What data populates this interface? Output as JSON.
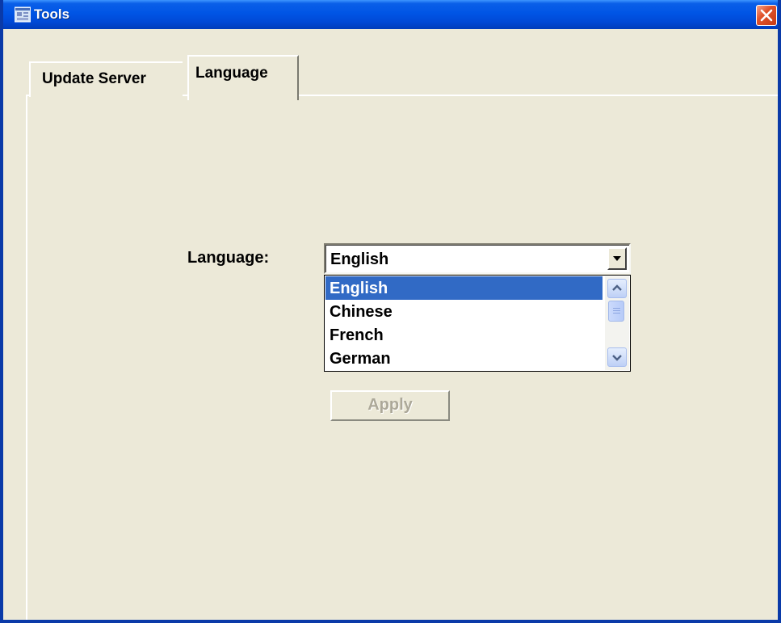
{
  "window": {
    "title": "Tools"
  },
  "tabs": [
    {
      "label": "Update Server",
      "active": false
    },
    {
      "label": "Language",
      "active": true
    }
  ],
  "language": {
    "label": "Language:",
    "selected": "English",
    "options": [
      "English",
      "Chinese",
      "French",
      "German"
    ],
    "highlighted_index": 0
  },
  "apply_label": "Apply",
  "icons": {
    "app": "tools-app-icon",
    "close": "close-icon",
    "dropdown": "chevron-down-icon",
    "scroll_up": "scroll-up-icon",
    "scroll_down": "scroll-down-icon"
  },
  "colors": {
    "titlebar": "#0055E5",
    "close": "#E0532B",
    "selection": "#316AC5",
    "dialog_bg": "#ECE9D8",
    "disabled_text": "#ACA899"
  }
}
